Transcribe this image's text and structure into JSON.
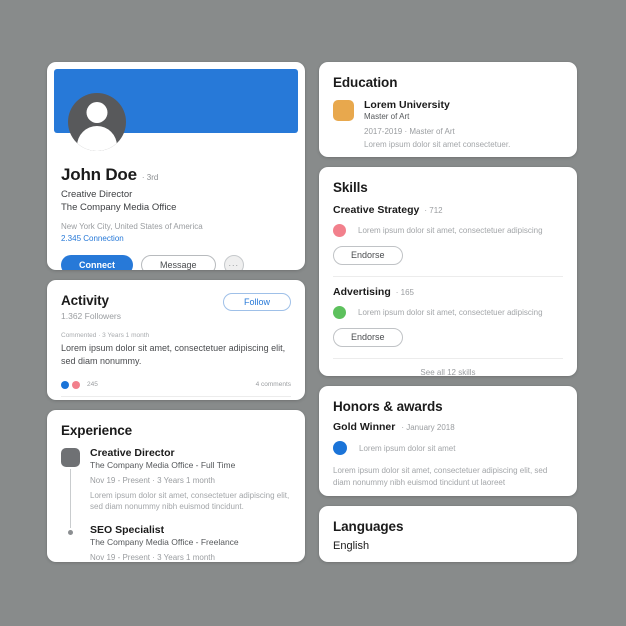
{
  "theme": {
    "background": "#888b8b",
    "card": "#ffffff",
    "accent_blue": "#2779d8",
    "avatar_gray": "#58595b",
    "education_orange": "#e8a84d",
    "skill_dot_pink": "#f2808c",
    "skill_dot_green": "#5dc15d",
    "honor_dot_blue": "#1b74d8",
    "experience_marker_gray": "#6f7174"
  },
  "profile": {
    "name": "John Doe",
    "degree_badge": "· 3rd",
    "title": "Creative Director",
    "company": "The Company Media Office",
    "location": "New York City, United States of America",
    "connections": "2.345 Connection",
    "connect_label": "Connect",
    "message_label": "Message",
    "more_label": "···"
  },
  "activity": {
    "title": "Activity",
    "follow_label": "Follow",
    "followers": "1.362 Followers",
    "post_meta": "Commented · 3 Years 1 month",
    "post_text": "Lorem ipsum dolor sit amet, consectetuer adipiscing elit, sed diam nonummy.",
    "reaction_count": "245",
    "comments": "4 comments"
  },
  "experience": {
    "title": "Experience",
    "items": [
      {
        "role": "Creative Director",
        "company": "The Company Media Office - Full Time",
        "dates": "Nov 19 - Present · 3 Years 1 month",
        "description": "Lorem ipsum dolor sit amet, consectetuer adipiscing elit, sed diam nonummy nibh euismod tincidunt."
      },
      {
        "role": "SEO Specialist",
        "company": "The Company Media Office - Freelance",
        "dates": "Nov 19 - Present · 3 Years 1 month",
        "description": ""
      }
    ]
  },
  "education": {
    "title": "Education",
    "school": "Lorem University",
    "degree": "Master of Art",
    "dates": "2017-2019 · Master of Art",
    "description": "Lorem ipsum dolor sit amet consectetuer."
  },
  "skills": {
    "title": "Skills",
    "items": [
      {
        "name": "Creative Strategy",
        "count": "· 712",
        "endorsement": "Lorem ipsum dolor sit amet, consectetuer adipiscing",
        "endorse_label": "Endorse"
      },
      {
        "name": "Advertising",
        "count": "· 165",
        "endorsement": "Lorem ipsum dolor sit amet, consectetuer adipiscing",
        "endorse_label": "Endorse"
      }
    ],
    "see_all": "See all 12 skills"
  },
  "honors": {
    "title": "Honors & awards",
    "award_name": "Gold Winner",
    "award_date": "· January 2018",
    "row_text": "Lorem ipsum dolor sit amet",
    "description": "Lorem ipsum dolor sit amet, consectetuer adipiscing elit, sed diam nonummy nibh euismod tincidunt ut laoreet"
  },
  "languages": {
    "title": "Languages",
    "value": "English"
  }
}
